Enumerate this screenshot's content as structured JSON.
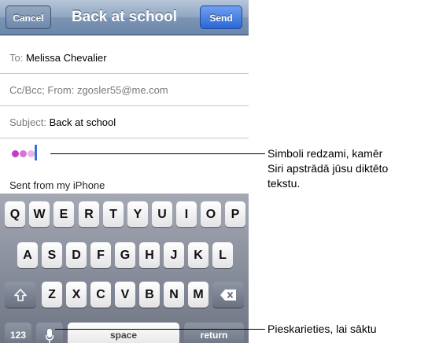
{
  "nav": {
    "title": "Back at school",
    "cancel_label": "Cancel",
    "send_label": "Send"
  },
  "fields": {
    "to_label": "To:",
    "to_value": "Melissa Chevalier",
    "cc_text": "Cc/Bcc; From: zgosler55@me.com",
    "subject_label": "Subject:",
    "subject_value": "Back at school"
  },
  "body": {
    "signature": "Sent from my iPhone",
    "dot_colors": [
      "#c33cc9",
      "#d277d6",
      "#e7b3ea"
    ]
  },
  "keyboard": {
    "row1": [
      "Q",
      "W",
      "E",
      "R",
      "T",
      "Y",
      "U",
      "I",
      "O",
      "P"
    ],
    "row2": [
      "A",
      "S",
      "D",
      "F",
      "G",
      "H",
      "J",
      "K",
      "L"
    ],
    "row3": [
      "Z",
      "X",
      "C",
      "V",
      "B",
      "N",
      "M"
    ],
    "numbers_label": "123",
    "space_label": "space",
    "return_label": "return",
    "shift_icon": "shift-icon",
    "delete_icon": "delete-icon",
    "mic_icon": "microphone-icon"
  },
  "callouts": {
    "dots": [
      "Simboli redzami, kamēr",
      "Siri apstrādā jūsu diktēto",
      "tekstu."
    ],
    "mic": "Pieskarieties, lai sāktu"
  }
}
